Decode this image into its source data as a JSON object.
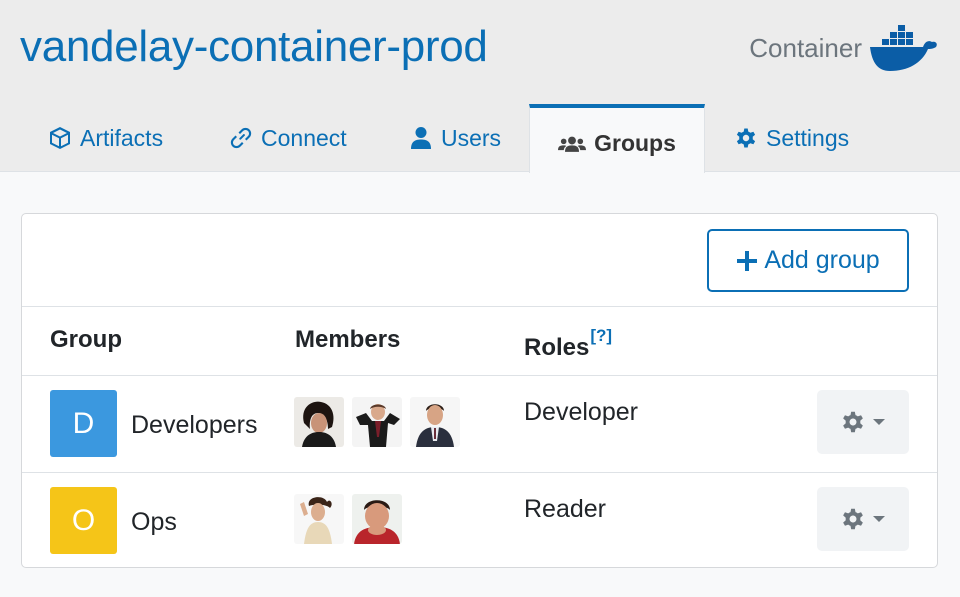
{
  "header": {
    "title": "vandelay-container-prod",
    "repo_type": "Container",
    "repo_icon": "docker-whale-icon"
  },
  "tabs": [
    {
      "label": "Artifacts",
      "icon": "cube-icon",
      "active": false
    },
    {
      "label": "Connect",
      "icon": "link-icon",
      "active": false
    },
    {
      "label": "Users",
      "icon": "user-icon",
      "active": false
    },
    {
      "label": "Groups",
      "icon": "users-icon",
      "active": true
    },
    {
      "label": "Settings",
      "icon": "gear-icon",
      "active": false
    }
  ],
  "actions": {
    "add_group": "Add group"
  },
  "table": {
    "headers": {
      "group": "Group",
      "members": "Members",
      "roles": "Roles",
      "roles_help": "[?]"
    },
    "rows": [
      {
        "initial": "D",
        "name": "Developers",
        "role": "Developer",
        "color": "#3b98df",
        "members": 3
      },
      {
        "initial": "O",
        "name": "Ops",
        "role": "Reader",
        "color": "#f5c518",
        "members": 2
      }
    ]
  },
  "colors": {
    "accent": "#0b6fb5",
    "background": "#f8f9fa",
    "header_bg": "#ececec"
  }
}
